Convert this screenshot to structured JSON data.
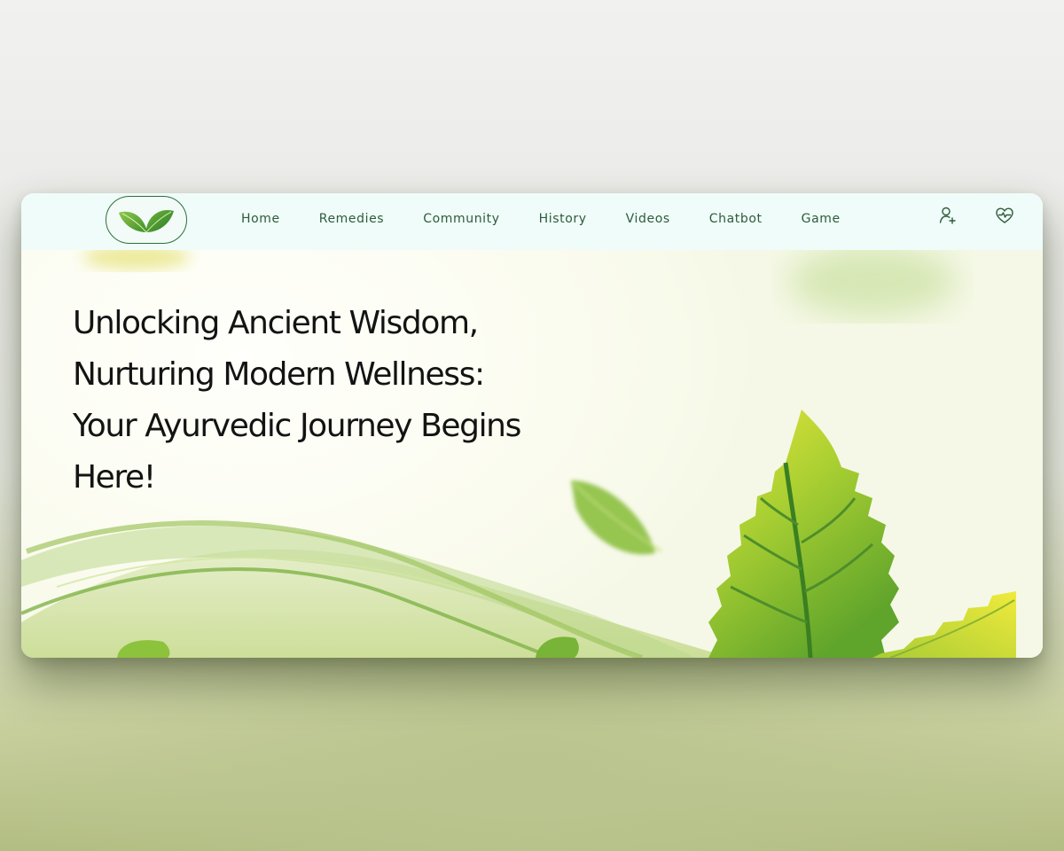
{
  "nav": {
    "links": [
      "Home",
      "Remedies",
      "Community",
      "History",
      "Videos",
      "Chatbot",
      "Game"
    ],
    "icons": [
      "user-add-icon",
      "heart-pulse-icon"
    ]
  },
  "hero": {
    "headline_lines": [
      "Unlocking Ancient Wisdom,",
      "Nurturing Modern Wellness:",
      "Your Ayurvedic Journey Begins",
      "Here!"
    ]
  },
  "colors": {
    "navbar_bg": "#effcf9",
    "nav_text": "#2f5a3c",
    "leaf_green": "#7cb342",
    "leaf_yellow": "#c6d82a",
    "logo_border": "#2e6e3a"
  }
}
